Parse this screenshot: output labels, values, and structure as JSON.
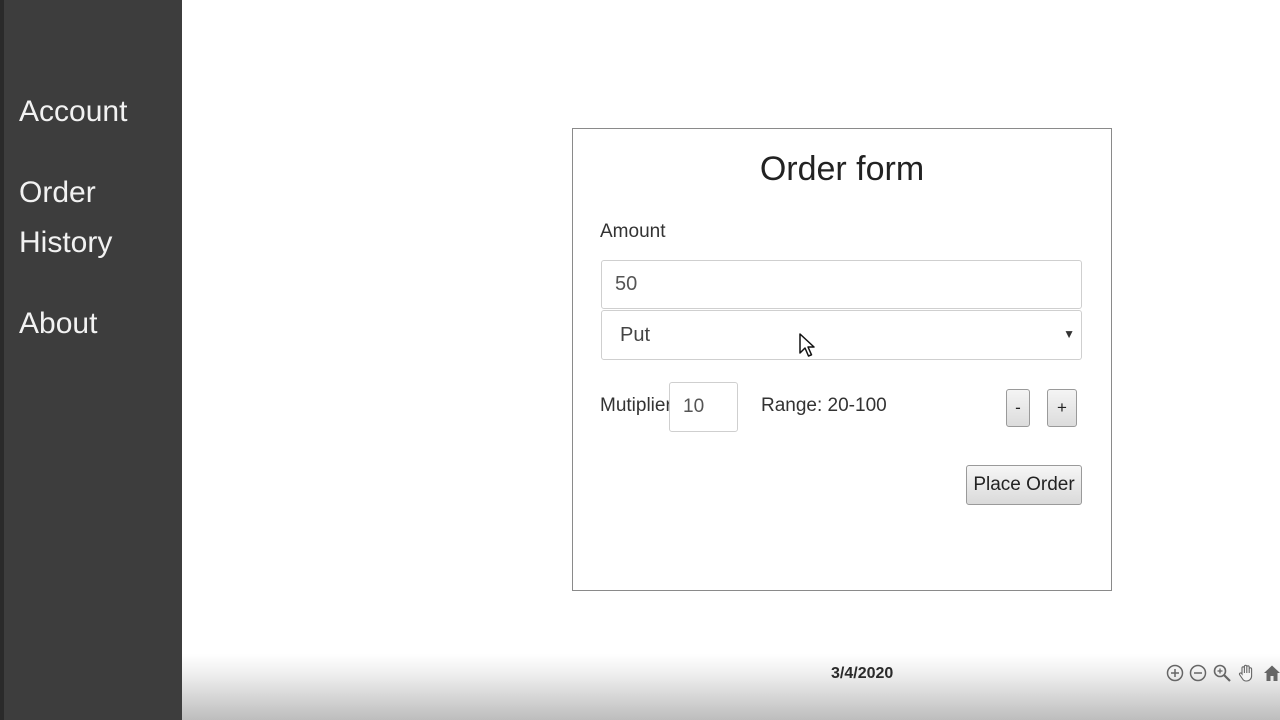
{
  "sidebar": {
    "items": [
      {
        "label": "Account"
      },
      {
        "label": "Order"
      },
      {
        "label": "History"
      },
      {
        "label": "About"
      }
    ]
  },
  "form": {
    "title": "Order form",
    "amount_label": "Amount",
    "amount_value": "50",
    "type_selected": "Put",
    "multiplier_label": "Mutiplier",
    "multiplier_value": "10",
    "range_text": "Range: 20-100",
    "minus_label": "-",
    "plus_label": "+",
    "place_order_label": "Place Order"
  },
  "footer": {
    "date": "3/4/2020",
    "tools": [
      "zoom-in-icon",
      "zoom-out-icon",
      "magnifier-icon",
      "pan-hand-icon",
      "home-icon"
    ]
  }
}
